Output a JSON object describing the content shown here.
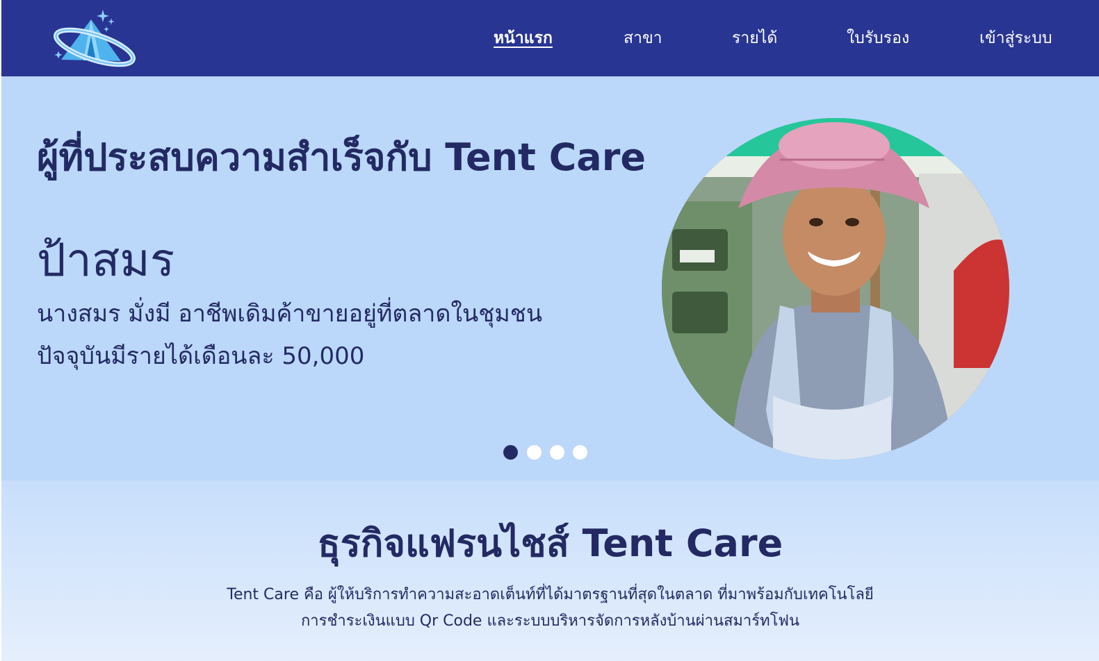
{
  "nav": {
    "items": [
      {
        "label": "หน้าแรก",
        "active": true
      },
      {
        "label": "สาขา",
        "active": false
      },
      {
        "label": "รายได้",
        "active": false
      },
      {
        "label": "ใบรับรอง",
        "active": false
      },
      {
        "label": "เข้าสู่ระบบ",
        "active": false
      }
    ]
  },
  "hero": {
    "heading": "ผู้ที่ประสบความสำเร็จกับ Tent Care",
    "name": "ป้าสมร",
    "description_lines": [
      "นางสมร มั่งมี อาชีพเดิมค้าขายอยู่ที่ตลาดในชุมชน",
      "ปัจจุบันมีรายได้เดือนละ 50,000"
    ],
    "carousel": {
      "total": 4,
      "active_index": 0
    }
  },
  "about": {
    "title": "ธุรกิจแฟรนไชส์ Tent Care",
    "description_lines": [
      "Tent Care คือ ผู้ให้บริการทำความสะอาดเต็นท์ที่ได้มาตรฐานที่สุดในตลาด ที่มาพร้อมกับเทคโนโลยี",
      "การชำระเงินแบบ Qr Code และระบบบริหารจัดการหลังบ้านผ่านสมาร์ทโฟน"
    ]
  },
  "colors": {
    "nav_bg": "#283593",
    "hero_bg": "#bbd8fb",
    "text_primary": "#232a63",
    "dot_inactive": "#ffffff"
  },
  "icons": {
    "logo": "tent-with-orbit-and-sparkles-icon"
  }
}
